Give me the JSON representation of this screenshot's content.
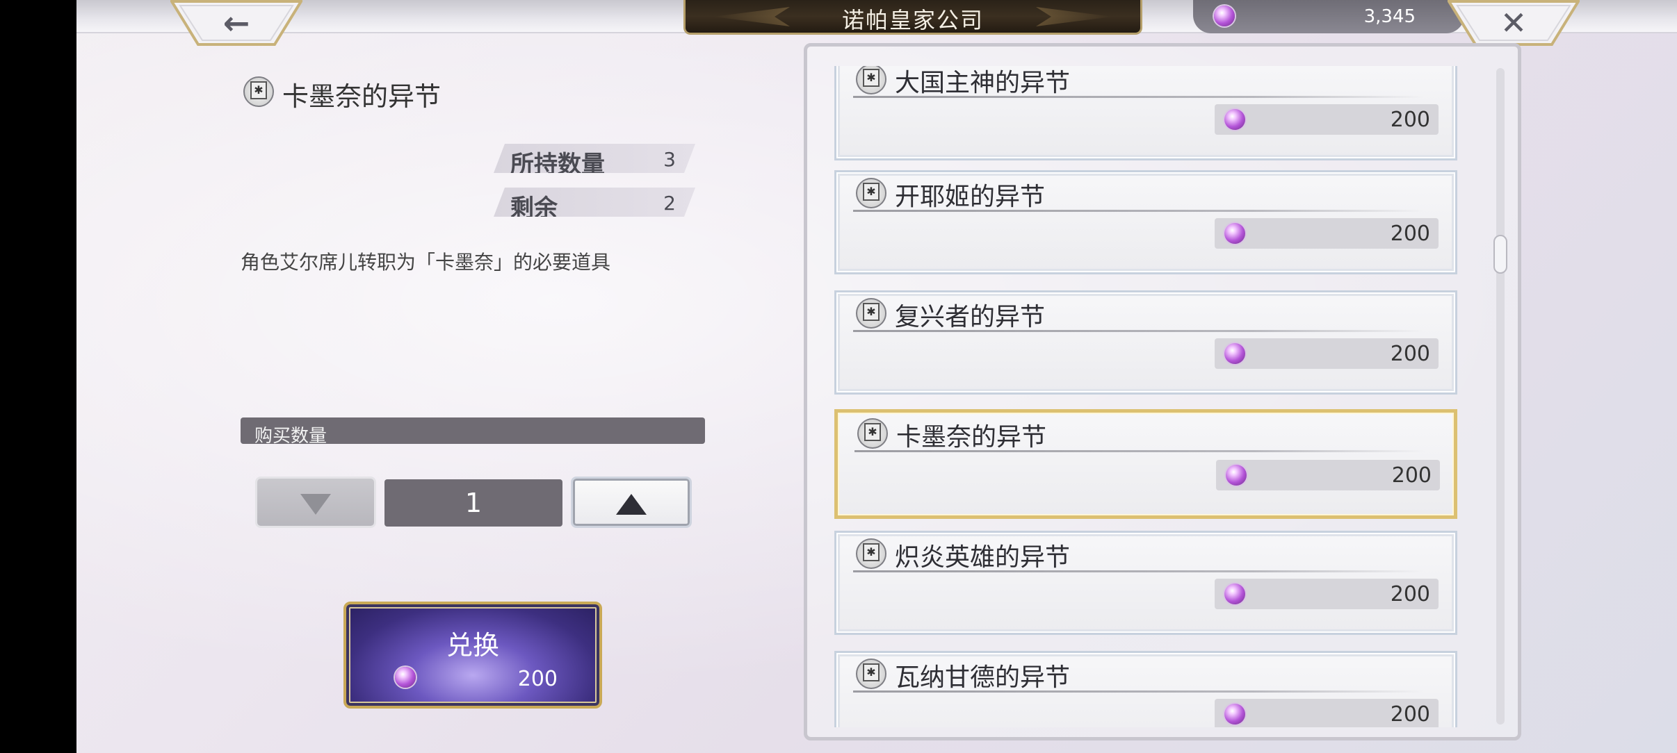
{
  "header": {
    "title": "诺帕皇家公司",
    "currency_amount": "3,345",
    "back_icon": "←",
    "close_icon": "✕"
  },
  "detail": {
    "item_name": "卡墨奈的异节",
    "owned_label": "所持数量",
    "owned_value": "3",
    "remaining_label": "剩余",
    "remaining_value": "2",
    "description": "角色艾尔席儿转职为「卡墨奈」的必要道具",
    "quantity_label": "购买数量",
    "quantity": "1",
    "exchange_label": "兑换",
    "exchange_price": "200"
  },
  "shop_list": [
    {
      "name": "大国主神的异节",
      "price": "200",
      "selected": false
    },
    {
      "name": "开耶姬的异节",
      "price": "200",
      "selected": false
    },
    {
      "name": "复兴者的异节",
      "price": "200",
      "selected": false
    },
    {
      "name": "卡墨奈的异节",
      "price": "200",
      "selected": true
    },
    {
      "name": "炽炎英雄的异节",
      "price": "200",
      "selected": false
    },
    {
      "name": "瓦纳甘德的异节",
      "price": "200",
      "selected": false
    }
  ],
  "colors": {
    "accent_gold": "#dcc071",
    "gem_purple": "#b455d8",
    "button_purple": "#6c58c0"
  }
}
